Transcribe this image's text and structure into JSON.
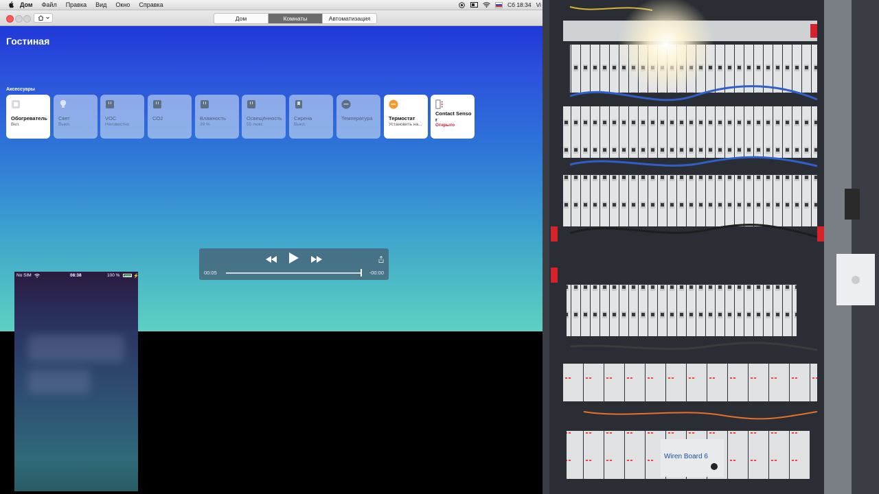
{
  "menubar": {
    "app_name": "Дом",
    "items": [
      "Файл",
      "Правка",
      "Вид",
      "Окно",
      "Справка"
    ],
    "clock": "Сб 18:34",
    "user_trunc": "Vi"
  },
  "toolbar": {
    "segments": [
      "Дом",
      "Комнаты",
      "Автоматизация"
    ],
    "active_segment": "Комнаты"
  },
  "room": {
    "title": "Гостиная",
    "section_label": "Аксессуары"
  },
  "tiles": [
    {
      "name": "Обогреватель",
      "status": "Вкл.",
      "on": true,
      "icon": "heater-icon"
    },
    {
      "name": "Свет",
      "status": "Выкл.",
      "on": false,
      "icon": "bulb-icon"
    },
    {
      "name": "VOC",
      "status": "Неизвестно",
      "on": false,
      "icon": "sensor-icon"
    },
    {
      "name": "CO2",
      "status": "",
      "on": false,
      "icon": "sensor-icon"
    },
    {
      "name": "Влажность",
      "status": "39 %",
      "on": false,
      "icon": "sensor-icon"
    },
    {
      "name": "Освещённость",
      "status": "55 люкс",
      "on": false,
      "icon": "sensor-icon"
    },
    {
      "name": "Сирена",
      "status": "Выкл.",
      "on": false,
      "icon": "siren-icon"
    },
    {
      "name": "Температура",
      "status": "",
      "on": false,
      "icon": "temperature-icon"
    },
    {
      "name": "Термостат",
      "status": "Установить на...",
      "on": true,
      "icon": "thermostat-icon"
    },
    {
      "name": "Contact Sensor",
      "status": "Открыто",
      "on": true,
      "icon": "contact-sensor-icon",
      "alert": true
    }
  ],
  "player": {
    "elapsed": "00:05",
    "remaining": "-00:00",
    "progress": 1.0
  },
  "phone": {
    "carrier": "No SIM",
    "time": "08:38",
    "battery": "100 %"
  },
  "colors": {
    "accent_orange": "#f39a2a",
    "alert_red": "#e0163a",
    "segment_active": "#6b6b6b"
  }
}
